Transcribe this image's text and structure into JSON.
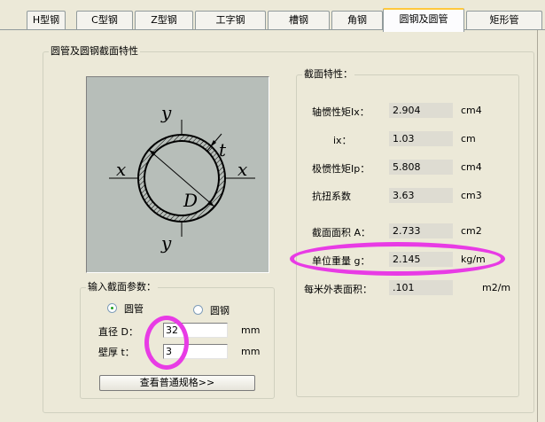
{
  "tabs": [
    {
      "label": "H型钢"
    },
    {
      "label": "C型钢"
    },
    {
      "label": "Z型钢"
    },
    {
      "label": "工字钢"
    },
    {
      "label": "槽钢"
    },
    {
      "label": "角钢"
    },
    {
      "label": "圆钢及圆管",
      "active": true
    },
    {
      "label": "矩形管"
    }
  ],
  "outer_group": {
    "title": "圆管及圆钢截面特性"
  },
  "diagram": {
    "labels": {
      "y_top": "y",
      "y_bottom": "y",
      "x_left": "x",
      "x_right": "x",
      "t": "t",
      "D": "D"
    }
  },
  "properties": {
    "title": "截面特性：",
    "rows": [
      {
        "label": "轴惯性矩Ix：",
        "value": "2.904",
        "unit": "cm4"
      },
      {
        "label": "ix：",
        "value": "1.03",
        "unit": "cm"
      },
      {
        "label": "极惯性矩Ip：",
        "value": "5.808",
        "unit": "cm4"
      },
      {
        "label": "抗扭系数",
        "value": "3.63",
        "unit": "cm3"
      },
      {
        "label": "截面面积 A：",
        "value": "2.733",
        "unit": "cm2"
      },
      {
        "label": "单位重量 g：",
        "value": "2.145",
        "unit": "kg/m"
      },
      {
        "label": "每米外表面积：",
        "value": ".101",
        "unit": "m2/m"
      }
    ]
  },
  "input": {
    "title": "输入截面参数：",
    "radio_tube": "圆管",
    "radio_bar": "圆钢",
    "selected": "圆管",
    "diameter_label": "直径 D：",
    "diameter_value": "32",
    "diameter_unit": "mm",
    "thickness_label": "壁厚 t：",
    "thickness_value": "3",
    "thickness_unit": "mm",
    "button_label": "查看普通规格>>"
  },
  "colors": {
    "highlight": "#E83BE5",
    "diagram_bg": "#B7BEB9",
    "window_bg": "#ECE9D8"
  }
}
